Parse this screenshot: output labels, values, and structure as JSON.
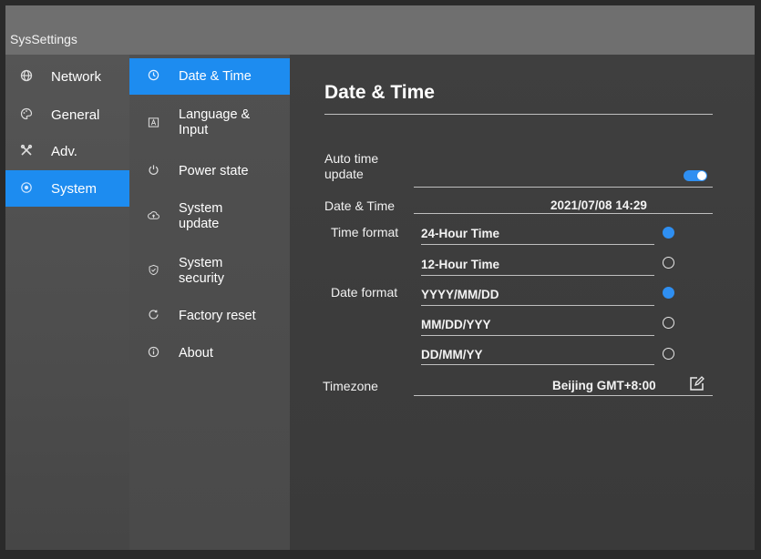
{
  "app": {
    "title": "SysSettings"
  },
  "sidebar": {
    "items": [
      {
        "label": "Network",
        "icon": "globe-icon"
      },
      {
        "label": "General",
        "icon": "palette-icon"
      },
      {
        "label": "Adv.",
        "icon": "tools-icon"
      },
      {
        "label": "System",
        "icon": "system-icon",
        "active": true
      }
    ]
  },
  "submenu": {
    "items": [
      {
        "label": "Date & Time",
        "icon": "clock-icon",
        "active": true
      },
      {
        "label": "Language &\nInput",
        "icon": "language-icon"
      },
      {
        "label": "Power state",
        "icon": "power-icon"
      },
      {
        "label": "System\nupdate",
        "icon": "cloud-upload-icon"
      },
      {
        "label": "System\nsecurity",
        "icon": "shield-icon"
      },
      {
        "label": "Factory reset",
        "icon": "reset-icon"
      },
      {
        "label": "About",
        "icon": "info-icon"
      }
    ]
  },
  "main": {
    "title": "Date & Time",
    "auto_time_update_label": "Auto time\nupdate",
    "auto_time_update_on": true,
    "date_time_label": "Date & Time",
    "date_time_value": "2021/07/08 14:29",
    "time_format_label": "Time format",
    "time_format_options": [
      "24-Hour Time",
      "12-Hour Time"
    ],
    "time_format_selected": "24-Hour Time",
    "date_format_label": "Date format",
    "date_format_options": [
      "YYYY/MM/DD",
      "MM/DD/YYY",
      "DD/MM/YY"
    ],
    "date_format_selected": "YYYY/MM/DD",
    "timezone_label": "Timezone",
    "timezone_value": "Beijing GMT+8:00"
  },
  "colors": {
    "accent": "#1d8cf0",
    "titlebar": "#6f6f6f"
  }
}
